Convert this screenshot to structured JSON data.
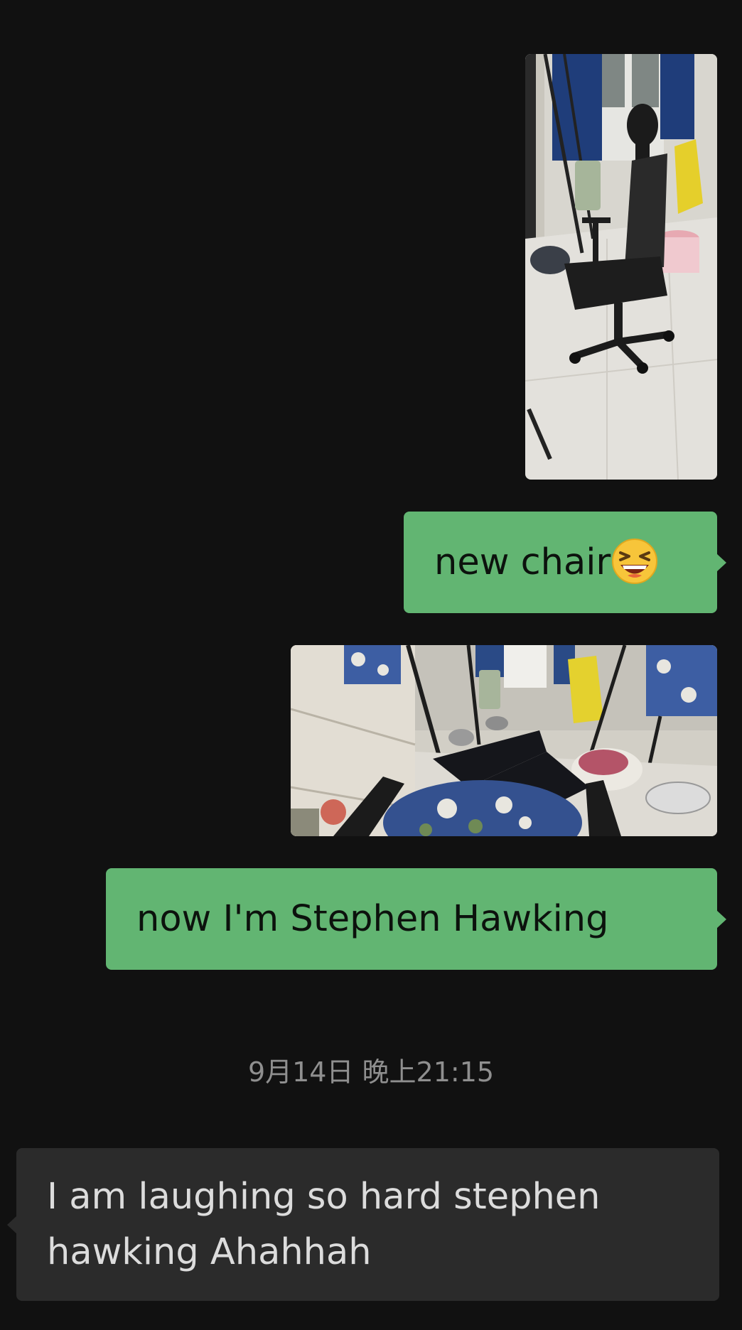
{
  "messages": [
    {
      "type": "image",
      "direction": "outgoing",
      "content": "photo of black mesh office chair in dorm room"
    },
    {
      "type": "text",
      "direction": "outgoing",
      "text": "new chair",
      "emoji": "laughing-squinting-face"
    },
    {
      "type": "image",
      "direction": "outgoing",
      "content": "photo from reclined chair looking at legs in dorm room"
    },
    {
      "type": "text",
      "direction": "outgoing",
      "text": "now I'm Stephen Hawking"
    },
    {
      "type": "timestamp",
      "text": "9月14日 晚上21:15"
    },
    {
      "type": "text",
      "direction": "incoming",
      "text": "I am laughing so hard stephen hawking Ahahhah"
    }
  ],
  "colors": {
    "background": "#111111",
    "outgoing_bubble": "#62b572",
    "incoming_bubble": "#2b2b2b",
    "incoming_text": "#dcdcdc",
    "timestamp_text": "#8f8f8f"
  }
}
